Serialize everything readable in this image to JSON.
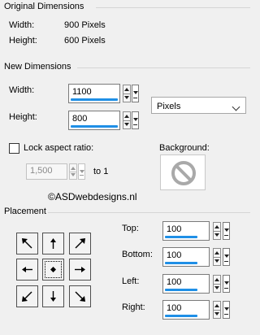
{
  "original": {
    "title": "Original Dimensions",
    "width_label": "Width:",
    "width_value": "900 Pixels",
    "height_label": "Height:",
    "height_value": "600 Pixels"
  },
  "new_dims": {
    "title": "New Dimensions",
    "width_label": "Width:",
    "width_value": "1100",
    "height_label": "Height:",
    "height_value": "800",
    "units_selected": "Pixels",
    "lock_label": "Lock aspect ratio:",
    "ratio_value": "1,500",
    "ratio_suffix": "to 1",
    "background_label": "Background:"
  },
  "watermark": "©ASDwebdesigns.nl",
  "placement": {
    "title": "Placement",
    "top_label": "Top:",
    "top_value": "100",
    "bottom_label": "Bottom:",
    "bottom_value": "100",
    "left_label": "Left:",
    "left_value": "100",
    "right_label": "Right:",
    "right_value": "100"
  },
  "icons": [
    "arrow-up-left-icon",
    "arrow-up-icon",
    "arrow-up-right-icon",
    "arrow-left-icon",
    "center-dot-icon",
    "arrow-right-icon",
    "arrow-down-left-icon",
    "arrow-down-icon",
    "arrow-down-right-icon",
    "no-background-icon"
  ],
  "colors": {
    "accent": "#1f8fe6",
    "panel": "#f0f0f0"
  }
}
